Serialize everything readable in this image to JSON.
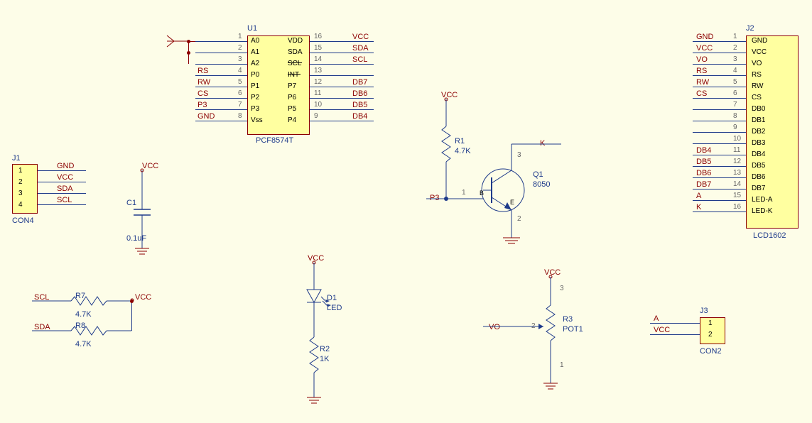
{
  "components": {
    "U1": {
      "ref": "U1",
      "value": "PCF8574T",
      "left_pins": [
        {
          "num": "1",
          "name": "A0",
          "net": ""
        },
        {
          "num": "2",
          "name": "A1",
          "net": ""
        },
        {
          "num": "3",
          "name": "A2",
          "net": ""
        },
        {
          "num": "4",
          "name": "P0",
          "net": "RS"
        },
        {
          "num": "5",
          "name": "P1",
          "net": "RW"
        },
        {
          "num": "6",
          "name": "P2",
          "net": "CS"
        },
        {
          "num": "7",
          "name": "P3",
          "net": "P3"
        },
        {
          "num": "8",
          "name": "Vss",
          "net": "GND"
        }
      ],
      "right_pins": [
        {
          "num": "16",
          "name": "VDD",
          "net": "VCC"
        },
        {
          "num": "15",
          "name": "SDA",
          "net": "SDA"
        },
        {
          "num": "14",
          "name": "SCL",
          "net": "SCL"
        },
        {
          "num": "13",
          "name": "INT",
          "net": ""
        },
        {
          "num": "12",
          "name": "P7",
          "net": "DB7"
        },
        {
          "num": "11",
          "name": "P6",
          "net": "DB6"
        },
        {
          "num": "10",
          "name": "P5",
          "net": "DB5"
        },
        {
          "num": "9",
          "name": "P4",
          "net": "DB4"
        }
      ]
    },
    "J1": {
      "ref": "J1",
      "value": "CON4",
      "pins": [
        {
          "num": "1",
          "net": "GND"
        },
        {
          "num": "2",
          "net": "VCC"
        },
        {
          "num": "3",
          "net": "SDA"
        },
        {
          "num": "4",
          "net": "SCL"
        }
      ]
    },
    "J2": {
      "ref": "J2",
      "value": "LCD1602",
      "pins": [
        {
          "num": "1",
          "name": "GND",
          "net": "GND"
        },
        {
          "num": "2",
          "name": "VCC",
          "net": "VCC"
        },
        {
          "num": "3",
          "name": "VO",
          "net": "VO"
        },
        {
          "num": "4",
          "name": "RS",
          "net": "RS"
        },
        {
          "num": "5",
          "name": "RW",
          "net": "RW"
        },
        {
          "num": "6",
          "name": "CS",
          "net": "CS"
        },
        {
          "num": "7",
          "name": "DB0",
          "net": ""
        },
        {
          "num": "8",
          "name": "DB1",
          "net": ""
        },
        {
          "num": "9",
          "name": "DB2",
          "net": ""
        },
        {
          "num": "10",
          "name": "DB3",
          "net": ""
        },
        {
          "num": "11",
          "name": "DB4",
          "net": "DB4"
        },
        {
          "num": "12",
          "name": "DB5",
          "net": "DB5"
        },
        {
          "num": "13",
          "name": "DB6",
          "net": "DB6"
        },
        {
          "num": "14",
          "name": "DB7",
          "net": "DB7"
        },
        {
          "num": "15",
          "name": "LED-A",
          "net": "A"
        },
        {
          "num": "16",
          "name": "LED-K",
          "net": "K"
        }
      ]
    },
    "J3": {
      "ref": "J3",
      "value": "CON2",
      "pins": [
        {
          "num": "1",
          "net": "A"
        },
        {
          "num": "2",
          "net": "VCC"
        }
      ]
    },
    "C1": {
      "ref": "C1",
      "value": "0.1uF",
      "net_top": "VCC"
    },
    "R1": {
      "ref": "R1",
      "value": "4.7K"
    },
    "R2": {
      "ref": "R2",
      "value": "1K"
    },
    "R3": {
      "ref": "R3",
      "value": "POT1"
    },
    "R7": {
      "ref": "R7",
      "value": "4.7K",
      "net_left": "SCL",
      "net_right": "VCC"
    },
    "R8": {
      "ref": "R8",
      "value": "4.7K",
      "net_left": "SDA"
    },
    "D1": {
      "ref": "D1",
      "value": "LED",
      "net_top": "VCC"
    },
    "Q1": {
      "ref": "Q1",
      "value": "8050",
      "net_base": "P3",
      "net_collector": "K",
      "net_r_top": "VCC"
    },
    "POT": {
      "net_top": "VCC",
      "net_wiper": "VO"
    }
  }
}
